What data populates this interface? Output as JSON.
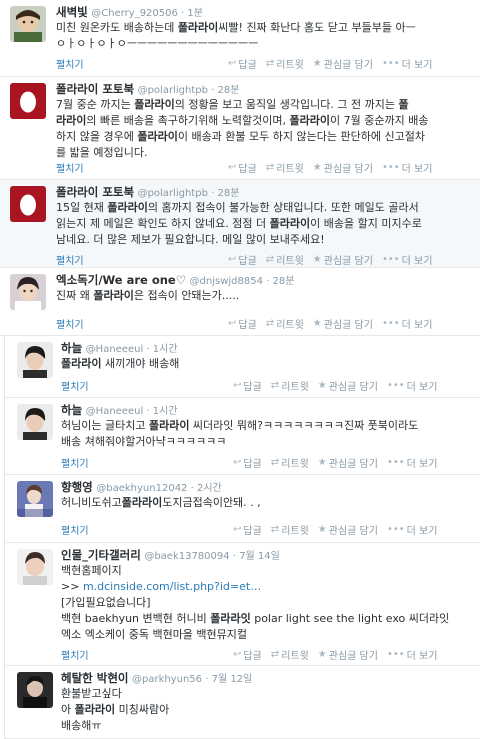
{
  "actions": {
    "reply": "답글",
    "retweet": "리트윗",
    "favorite": "관심글 담기",
    "more": "더 보기"
  },
  "tweets": [
    {
      "name": "새벽빛",
      "handle": "@Cherry_920506",
      "time": "1분",
      "lines": [
        [
          {
            "t": "미친 원온카도 배송하는데 "
          },
          {
            "t": "폴라라이",
            "b": true
          },
          {
            "t": "씨빨! 진짜 화난다 홈도 닫고 부들부들 아ㅡ"
          }
        ],
        [
          {
            "t": "ㅇㅏㅇㅏㅇㅏㅇㅡㅡㅡㅡㅡㅡㅡㅡㅡㅡㅡㅡㅡ"
          }
        ]
      ],
      "expand": "펼치기"
    },
    {
      "name": "폴라라이 포토북",
      "handle": "@polarlightpb",
      "time": "28분",
      "lines": [
        [
          {
            "t": "7월 중순 까지는 "
          },
          {
            "t": "폴라라이",
            "b": true
          },
          {
            "t": "의 정황을 보고 움직일 생각입니다. 그 전 까지는 "
          },
          {
            "t": "폴",
            "b": true
          }
        ],
        [
          {
            "t": "라라이",
            "b": true
          },
          {
            "t": "의 빠른 배송을 촉구하기위해 노력할것이며, "
          },
          {
            "t": "폴라라이",
            "b": true
          },
          {
            "t": "이 7월 중순까지 배송"
          }
        ],
        [
          {
            "t": "하지 않을 경우에 "
          },
          {
            "t": "폴라라이",
            "b": true
          },
          {
            "t": "이 배송과 환불 모두 하지 않는다는 판단하에 신고절차"
          }
        ],
        [
          {
            "t": "를 밟을 예정입니다."
          }
        ]
      ],
      "expand": "펼치기"
    },
    {
      "name": "폴라라이 포토북",
      "handle": "@polarlightpb",
      "time": "28분",
      "lines": [
        [
          {
            "t": "15일 현재 "
          },
          {
            "t": "폴라라이",
            "b": true
          },
          {
            "t": "의 홈까지 접속이 불가능한 상태입니다. 또한 메일도 골라서"
          }
        ],
        [
          {
            "t": "읽는지 제 메일은 확인도 하지 않네요. 점점 더 "
          },
          {
            "t": "폴라라이",
            "b": true
          },
          {
            "t": "이 배송을 할지 미지수로"
          }
        ],
        [
          {
            "t": "남네요. 더 많은 제보가 필요합니다. 메일 많이 보내주세요!"
          }
        ]
      ],
      "expand": "펼치기"
    },
    {
      "name": "엑소독기/We are one♡",
      "handle": "@dnjswjd8854",
      "time": "28분",
      "lines": [
        [
          {
            "t": "진짜 왜 "
          },
          {
            "t": "폴라라이",
            "b": true
          },
          {
            "t": "은 접속이 안돼는가....."
          }
        ]
      ],
      "expand": "펼치기"
    },
    {
      "name": "하늘",
      "handle": "@Haneeeul",
      "time": "1시간",
      "lines": [
        [
          {
            "t": "폴라라이",
            "b": true
          },
          {
            "t": " 새끼개야 배송해"
          }
        ]
      ],
      "expand": "펼치기"
    },
    {
      "name": "하늘",
      "handle": "@Haneeeul",
      "time": "1시간",
      "lines": [
        [
          {
            "t": "허님이는 글타치고 "
          },
          {
            "t": "폴라라이",
            "b": true
          },
          {
            "t": " 씨더라잇 뭐해?ㅋㅋㅋㅋㅋㅋㅋㅋ진짜 풋북이라도"
          }
        ],
        [
          {
            "t": "배송 쳐해줘야할거아냑ㅋㅋㅋㅋㅋㅋ"
          }
        ]
      ],
      "expand": "펼치기"
    },
    {
      "name": "향행영",
      "handle": "@baekhyun12042",
      "time": "2시간",
      "lines": [
        [
          {
            "t": "허니비도쉬고"
          },
          {
            "t": "폴라라이",
            "b": true
          },
          {
            "t": "도지금접속이안돼. . ,"
          }
        ]
      ],
      "expand": "펼치기"
    },
    {
      "name": "인물_기타갤러리",
      "handle": "@baek13780094",
      "time": "7월 14일",
      "lines": [
        [
          {
            "t": "백현홈페이지"
          }
        ],
        [
          {
            "t": ">> "
          },
          {
            "t": "m.dcinside.com/list.php?id=et…",
            "link": true
          }
        ],
        [
          {
            "t": "[가입필요없습니다]"
          }
        ],
        [
          {
            "t": "백현 baekhyun 변백현 허니비 "
          },
          {
            "t": "폴라라잇",
            "b": true
          },
          {
            "t": " polar light see the light exo 씨더라잇"
          }
        ],
        [
          {
            "t": "엑소 엑소케이 중독 백현마을 백현뮤지컬"
          }
        ]
      ],
      "expand": "펼치기"
    },
    {
      "name": "헤탈한 박현이",
      "handle": "@parkhyun56",
      "time": "7월 12일",
      "lines": [
        [
          {
            "t": "환불받고싶다"
          }
        ],
        [
          {
            "t": "아 "
          },
          {
            "t": "폴라라이",
            "b": true
          },
          {
            "t": " 미칭싸람아"
          }
        ],
        [
          {
            "t": "배송해ㅠ"
          }
        ]
      ],
      "expand": ""
    }
  ],
  "colors": {
    "accent_link": "#2b7bb9",
    "meta_gray": "#8899a6",
    "highlight_bg": "#f5f8fa"
  },
  "icons": [
    "reply-icon",
    "retweet-icon",
    "star-icon",
    "more-icon"
  ]
}
